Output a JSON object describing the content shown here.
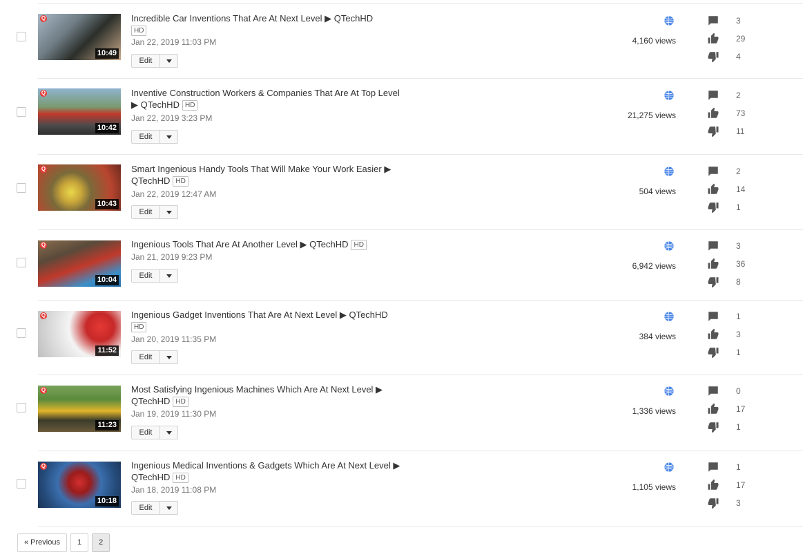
{
  "videos": [
    {
      "title": "Incredible Car Inventions That Are At Next Level ▶ QTechHD",
      "hd": "HD",
      "date": "Jan 22, 2019 11:03 PM",
      "duration": "10:49",
      "views": "4,160 views",
      "comments": "3",
      "likes": "29",
      "dislikes": "4",
      "edit": "Edit"
    },
    {
      "title": "Inventive Construction Workers & Companies That Are At Top Level ▶ QTechHD",
      "hd": "HD",
      "date": "Jan 22, 2019 3:23 PM",
      "duration": "10:42",
      "views": "21,275 views",
      "comments": "2",
      "likes": "73",
      "dislikes": "11",
      "edit": "Edit"
    },
    {
      "title": "Smart Ingenious Handy Tools That Will Make Your Work Easier ▶ QTechHD",
      "hd": "HD",
      "date": "Jan 22, 2019 12:47 AM",
      "duration": "10:43",
      "views": "504 views",
      "comments": "2",
      "likes": "14",
      "dislikes": "1",
      "edit": "Edit"
    },
    {
      "title": "Ingenious Tools That Are At Another Level ▶ QTechHD",
      "hd": "HD",
      "date": "Jan 21, 2019 9:23 PM",
      "duration": "10:04",
      "views": "6,942 views",
      "comments": "3",
      "likes": "36",
      "dislikes": "8",
      "edit": "Edit"
    },
    {
      "title": "Ingenious Gadget Inventions That Are At Next Level ▶ QTechHD",
      "hd": "HD",
      "date": "Jan 20, 2019 11:35 PM",
      "duration": "11:52",
      "views": "384 views",
      "comments": "1",
      "likes": "3",
      "dislikes": "1",
      "edit": "Edit"
    },
    {
      "title": "Most Satisfying Ingenious Machines Which Are At Next Level ▶ QTechHD",
      "hd": "HD",
      "date": "Jan 19, 2019 11:30 PM",
      "duration": "11:23",
      "views": "1,336 views",
      "comments": "0",
      "likes": "17",
      "dislikes": "1",
      "edit": "Edit"
    },
    {
      "title": "Ingenious Medical Inventions & Gadgets Which Are At Next Level ▶ QTechHD",
      "hd": "HD",
      "date": "Jan 18, 2019 11:08 PM",
      "duration": "10:18",
      "views": "1,105 views",
      "comments": "1",
      "likes": "17",
      "dislikes": "3",
      "edit": "Edit"
    }
  ],
  "pagination": {
    "previous": "« Previous",
    "page1": "1",
    "page2": "2"
  },
  "colors": {
    "globe": "#4a86e8",
    "icon": "#555555",
    "badge": "#e53935"
  },
  "icons": {
    "visibility": "globe-icon",
    "comments": "comment-icon",
    "likes": "thumbs-up-icon",
    "dislikes": "thumbs-down-icon",
    "duration_badge": "channel-badge-icon"
  }
}
